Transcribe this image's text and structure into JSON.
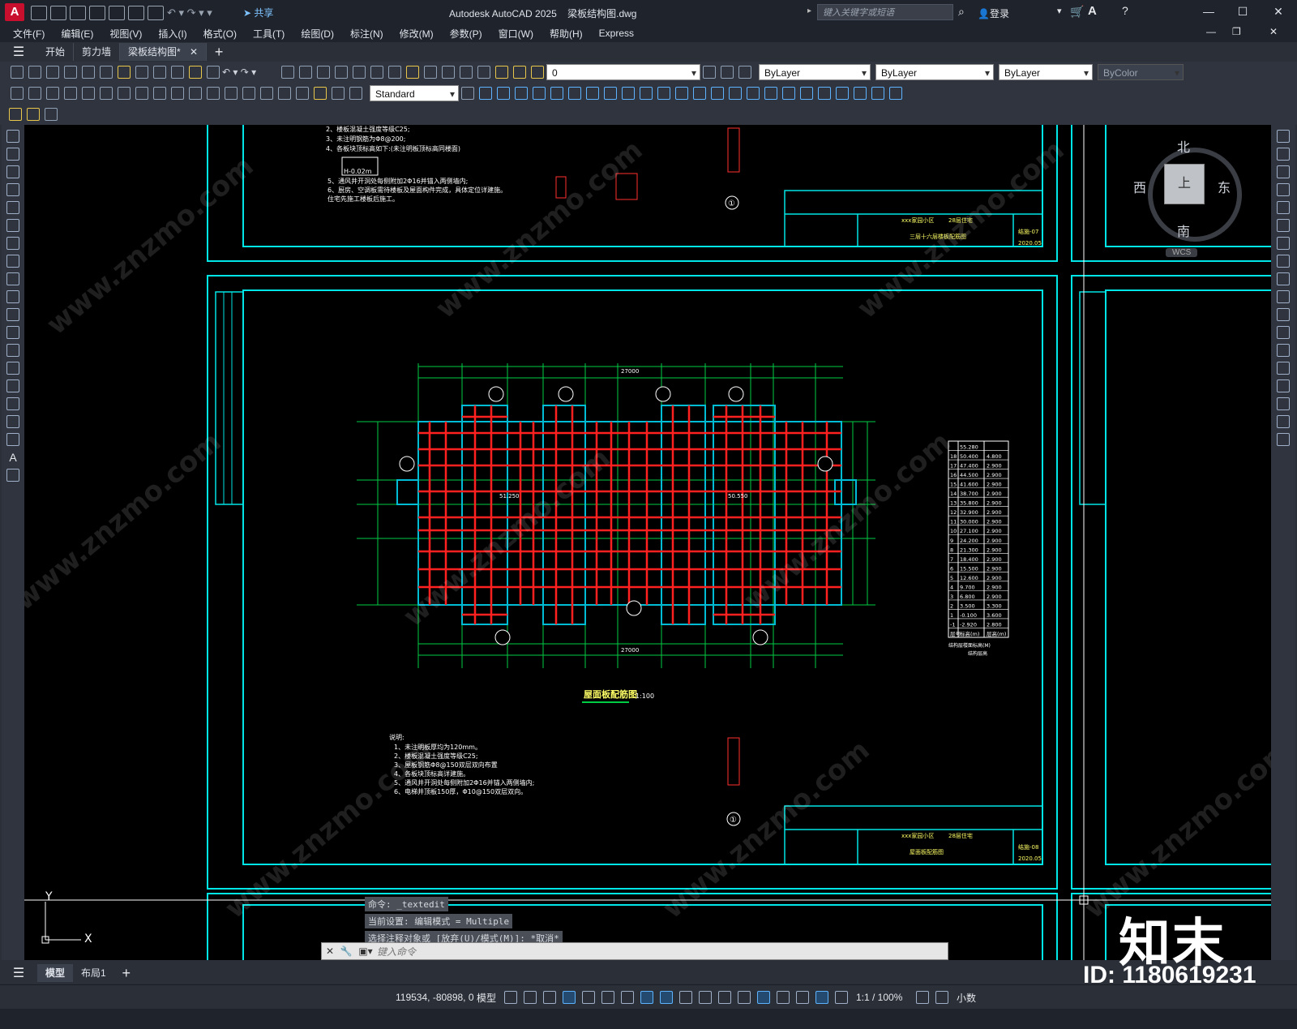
{
  "app": {
    "title": "Autodesk AutoCAD 2025",
    "document": "梁板结构图.dwg",
    "icon_letter": "A",
    "share_label": "共享",
    "search_placeholder": "键入关键字或短语",
    "login_label": "登录"
  },
  "menu": [
    "文件(F)",
    "编辑(E)",
    "视图(V)",
    "插入(I)",
    "格式(O)",
    "工具(T)",
    "绘图(D)",
    "标注(N)",
    "修改(M)",
    "参数(P)",
    "窗口(W)",
    "帮助(H)",
    "Express"
  ],
  "doc_tabs": [
    "开始",
    "剪力墙",
    "梁板结构图*"
  ],
  "toolbar": {
    "layer_value": "0",
    "color_value": "ByLayer",
    "linetype_value": "ByLayer",
    "lineweight_value": "ByLayer",
    "plotstyle_value": "ByColor",
    "dimstyle_value": "Standard"
  },
  "viewcube": {
    "north": "北",
    "south": "南",
    "east": "东",
    "west": "西",
    "top": "上",
    "wcs": "WCS"
  },
  "drawing": {
    "plan_title": "屋面板配筋图",
    "plan_scale": "1:100",
    "overall_dim": "27000",
    "title_block_1": {
      "project": "xxx家园小区",
      "building": "28层住宅",
      "name": "三层十六层楼板配筋图",
      "no": "结施-07",
      "date": "2020.05"
    },
    "title_block_2": {
      "project": "xxx家园小区",
      "building": "28层住宅",
      "name": "屋面板配筋图",
      "no": "结施-08",
      "date": "2020.05"
    },
    "notes_top": [
      "2、楼板混凝土强度等级C25;",
      "3、未注明钢筋为Φ8@200;",
      "4、各板块顶标高如下:(未注明板顶标高同楼面)",
      "5、通风井开洞处每侧附加2Φ16并锚入两侧墙内;",
      "6、厨房、空调板需待楼板及屋面构件完成，具体定位详建施。",
      "   住宅先施工楼板后施工。"
    ],
    "notes_top_elev": "H-0.02m",
    "notes_bottom_title": "说明:",
    "notes_bottom": [
      "1、未注明板厚均为120mm。",
      "2、楼板混凝土强度等级C25;",
      "3、屋板钢筋Φ8@150双层双向布置",
      "4、各板块顶标高详建施。",
      "5、通风井开洞处每侧附加2Φ16并锚入两侧墙内;",
      "6、电梯井顶板150厚，Φ10@150双层双向。"
    ],
    "elev_table_title": "结构层楼面标高(M)",
    "elev_table_subtitle": "结构层高",
    "elev_table": [
      [
        "",
        "55.280",
        ""
      ],
      [
        "18",
        "50.400",
        "4.800"
      ],
      [
        "17",
        "47.400",
        "2.900"
      ],
      [
        "16",
        "44.500",
        "2.900"
      ],
      [
        "15",
        "41.600",
        "2.900"
      ],
      [
        "14",
        "38.700",
        "2.900"
      ],
      [
        "13",
        "35.800",
        "2.900"
      ],
      [
        "12",
        "32.900",
        "2.900"
      ],
      [
        "11",
        "30.000",
        "2.900"
      ],
      [
        "10",
        "27.100",
        "2.900"
      ],
      [
        "9",
        "24.200",
        "2.900"
      ],
      [
        "8",
        "21.300",
        "2.900"
      ],
      [
        "7",
        "18.400",
        "2.900"
      ],
      [
        "6",
        "15.500",
        "2.900"
      ],
      [
        "5",
        "12.600",
        "2.900"
      ],
      [
        "4",
        "9.700",
        "2.900"
      ],
      [
        "3",
        "6.800",
        "2.900"
      ],
      [
        "2",
        "3.500",
        "3.300"
      ],
      [
        "1",
        "-0.100",
        "3.600"
      ],
      [
        "-1",
        "-2.920",
        "2.800"
      ]
    ],
    "elev_table_header": [
      "层号",
      "标高(m)",
      "层高(m)"
    ],
    "section_mark": "①",
    "elev_marks": [
      "51.250",
      "50.550"
    ]
  },
  "command": {
    "history": [
      "命令: _textedit",
      "当前设置: 编辑模式 = Multiple",
      "选择注释对象或 [放弃(U)/模式(M)]: *取消*"
    ],
    "placeholder": "键入命令"
  },
  "layout_tabs": [
    "模型",
    "布局1"
  ],
  "status": {
    "coords": "119534, -80898, 0",
    "model_label": "模型",
    "scale": "1:1 / 100%",
    "units": "小数"
  },
  "watermark": {
    "logo": "知末",
    "id": "ID: 1180619231",
    "site": "www.znzmo.com"
  }
}
